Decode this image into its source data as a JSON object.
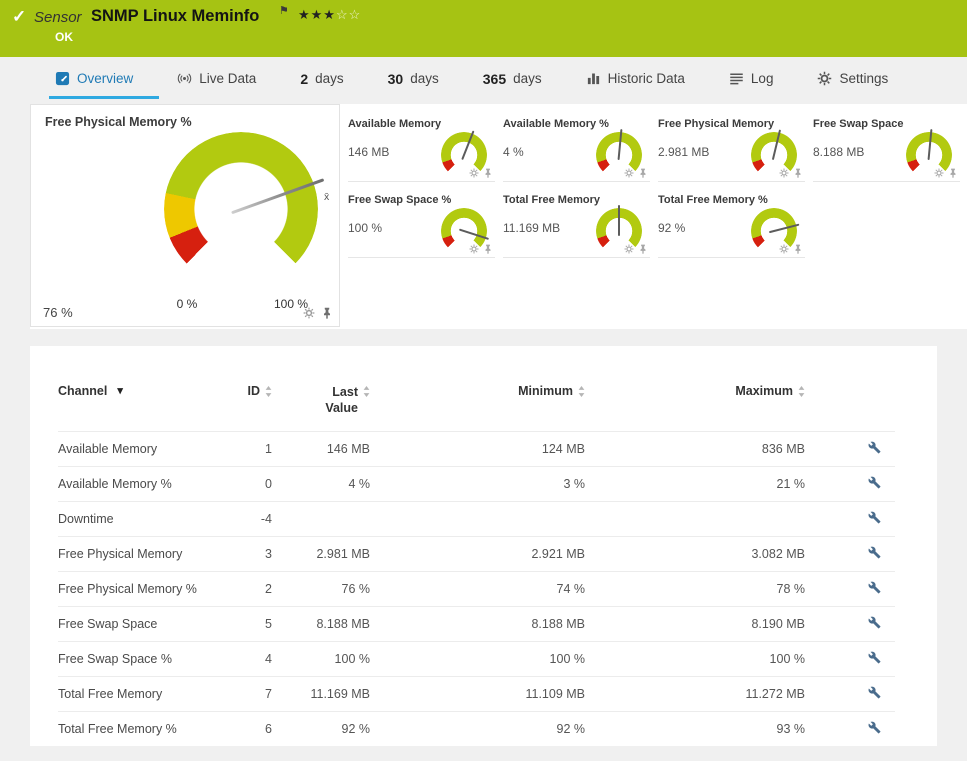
{
  "colors": {
    "header_green": "#a6c313",
    "accent_blue": "#1f7ab5",
    "underline_blue": "#2fa9e1",
    "gauge_green": "#b2ca10",
    "gauge_yellow": "#eec800",
    "gauge_red": "#d6200f"
  },
  "icons": {
    "check": "✓",
    "flag": "⚑",
    "caret_down": "▾",
    "stars_filled": "★★★",
    "stars_empty": "☆☆",
    "mean_symbol": "x̄"
  },
  "header": {
    "kind": "Sensor",
    "title": "SNMP Linux Meminfo",
    "status": "OK"
  },
  "tabs": [
    {
      "label": "Overview"
    },
    {
      "label": "Live Data"
    },
    {
      "num": "2",
      "label": "days"
    },
    {
      "num": "30",
      "label": "days"
    },
    {
      "num": "365",
      "label": "days"
    },
    {
      "label": "Historic Data"
    },
    {
      "label": "Log"
    },
    {
      "label": "Settings"
    }
  ],
  "main_gauge": {
    "title": "Free Physical Memory %",
    "value": "76 %",
    "scale_min": "0 %",
    "scale_max": "100 %",
    "percent": 76
  },
  "mini_gauges": [
    {
      "title": "Available Memory",
      "value": "146 MB",
      "percent": 58
    },
    {
      "title": "Available Memory %",
      "value": "4 %",
      "percent": 52
    },
    {
      "title": "Free Physical Memory",
      "value": "2.981 MB",
      "percent": 55
    },
    {
      "title": "Free Swap Space",
      "value": "8.188 MB",
      "percent": 52
    },
    {
      "title": "Free Swap Space %",
      "value": "100 %",
      "percent": 90
    },
    {
      "title": "Total Free Memory",
      "value": "11.169 MB",
      "percent": 50
    },
    {
      "title": "Total Free Memory %",
      "value": "92 %",
      "percent": 78
    }
  ],
  "table": {
    "headers": {
      "channel": "Channel",
      "id": "ID",
      "last_value": "Last Value",
      "minimum": "Minimum",
      "maximum": "Maximum"
    },
    "rows": [
      {
        "channel": "Available Memory",
        "id": "1",
        "last": "146 MB",
        "min": "124 MB",
        "max": "836 MB"
      },
      {
        "channel": "Available Memory %",
        "id": "0",
        "last": "4 %",
        "min": "3 %",
        "max": "21 %"
      },
      {
        "channel": "Downtime",
        "id": "-4",
        "last": "",
        "min": "",
        "max": ""
      },
      {
        "channel": "Free Physical Memory",
        "id": "3",
        "last": "2.981 MB",
        "min": "2.921 MB",
        "max": "3.082 MB"
      },
      {
        "channel": "Free Physical Memory %",
        "id": "2",
        "last": "76 %",
        "min": "74 %",
        "max": "78 %"
      },
      {
        "channel": "Free Swap Space",
        "id": "5",
        "last": "8.188 MB",
        "min": "8.188 MB",
        "max": "8.190 MB"
      },
      {
        "channel": "Free Swap Space %",
        "id": "4",
        "last": "100 %",
        "min": "100 %",
        "max": "100 %"
      },
      {
        "channel": "Total Free Memory",
        "id": "7",
        "last": "11.169 MB",
        "min": "11.109 MB",
        "max": "11.272 MB"
      },
      {
        "channel": "Total Free Memory %",
        "id": "6",
        "last": "92 %",
        "min": "92 %",
        "max": "93 %"
      }
    ]
  }
}
